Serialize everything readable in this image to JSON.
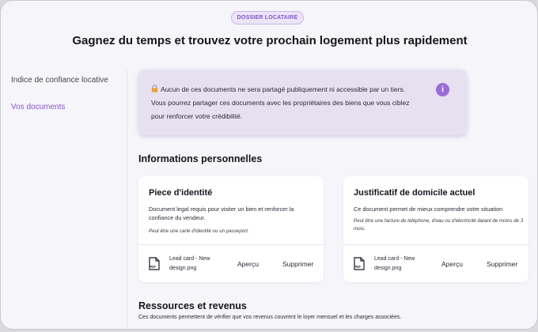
{
  "badge": "DOSSIER LOCATAIRE",
  "headline": "Gagnez du temps et trouvez votre prochain logement plus rapidement",
  "sidebar": {
    "items": [
      {
        "label": "Indice de confiance locative"
      },
      {
        "label": "Vos documents"
      }
    ]
  },
  "info": {
    "line1": "Aucun de ces documents ne sera partagé publiquement ni accessible par un tiers.",
    "line2": "Vous pourrez partager ces documents avec les propriétaires des biens que vous ciblez",
    "line3": "pour renforcer votre crédibilité.",
    "icon_label": "i"
  },
  "sections": {
    "personal": {
      "title": "Informations personnelles"
    },
    "resources": {
      "title": "Ressources et revenus",
      "description": "Ces documents permettent de vérifier que vos revenus couvrent le loyer mensuel et les charges associées."
    }
  },
  "cards": [
    {
      "title": "Piece d'identité",
      "description": "Document legal requis pour visiter un bien et renforcer la confiance du vendeur.",
      "note": "Peut être une carte d'identité ou un passeport.",
      "file_name": "Lead card - New design.png",
      "view_label": "Aperçu",
      "delete_label": "Supprimer",
      "file_badge": "PDF"
    },
    {
      "title": "Justificatif de domicile actuel",
      "description": "Ce document permet de mieux comprendre votre situation",
      "note": "Peut être une facture de téléphone, d'eau ou d'électricité datant de moins de 3 mois.",
      "file_name": "Lead card - New design.png",
      "view_label": "Aperçu",
      "delete_label": "Supprimer",
      "file_badge": "PDF"
    }
  ],
  "colors": {
    "accent": "#8a55c9",
    "info_bg": "#e6e0f1",
    "badge_bg": "#ece4f7"
  }
}
